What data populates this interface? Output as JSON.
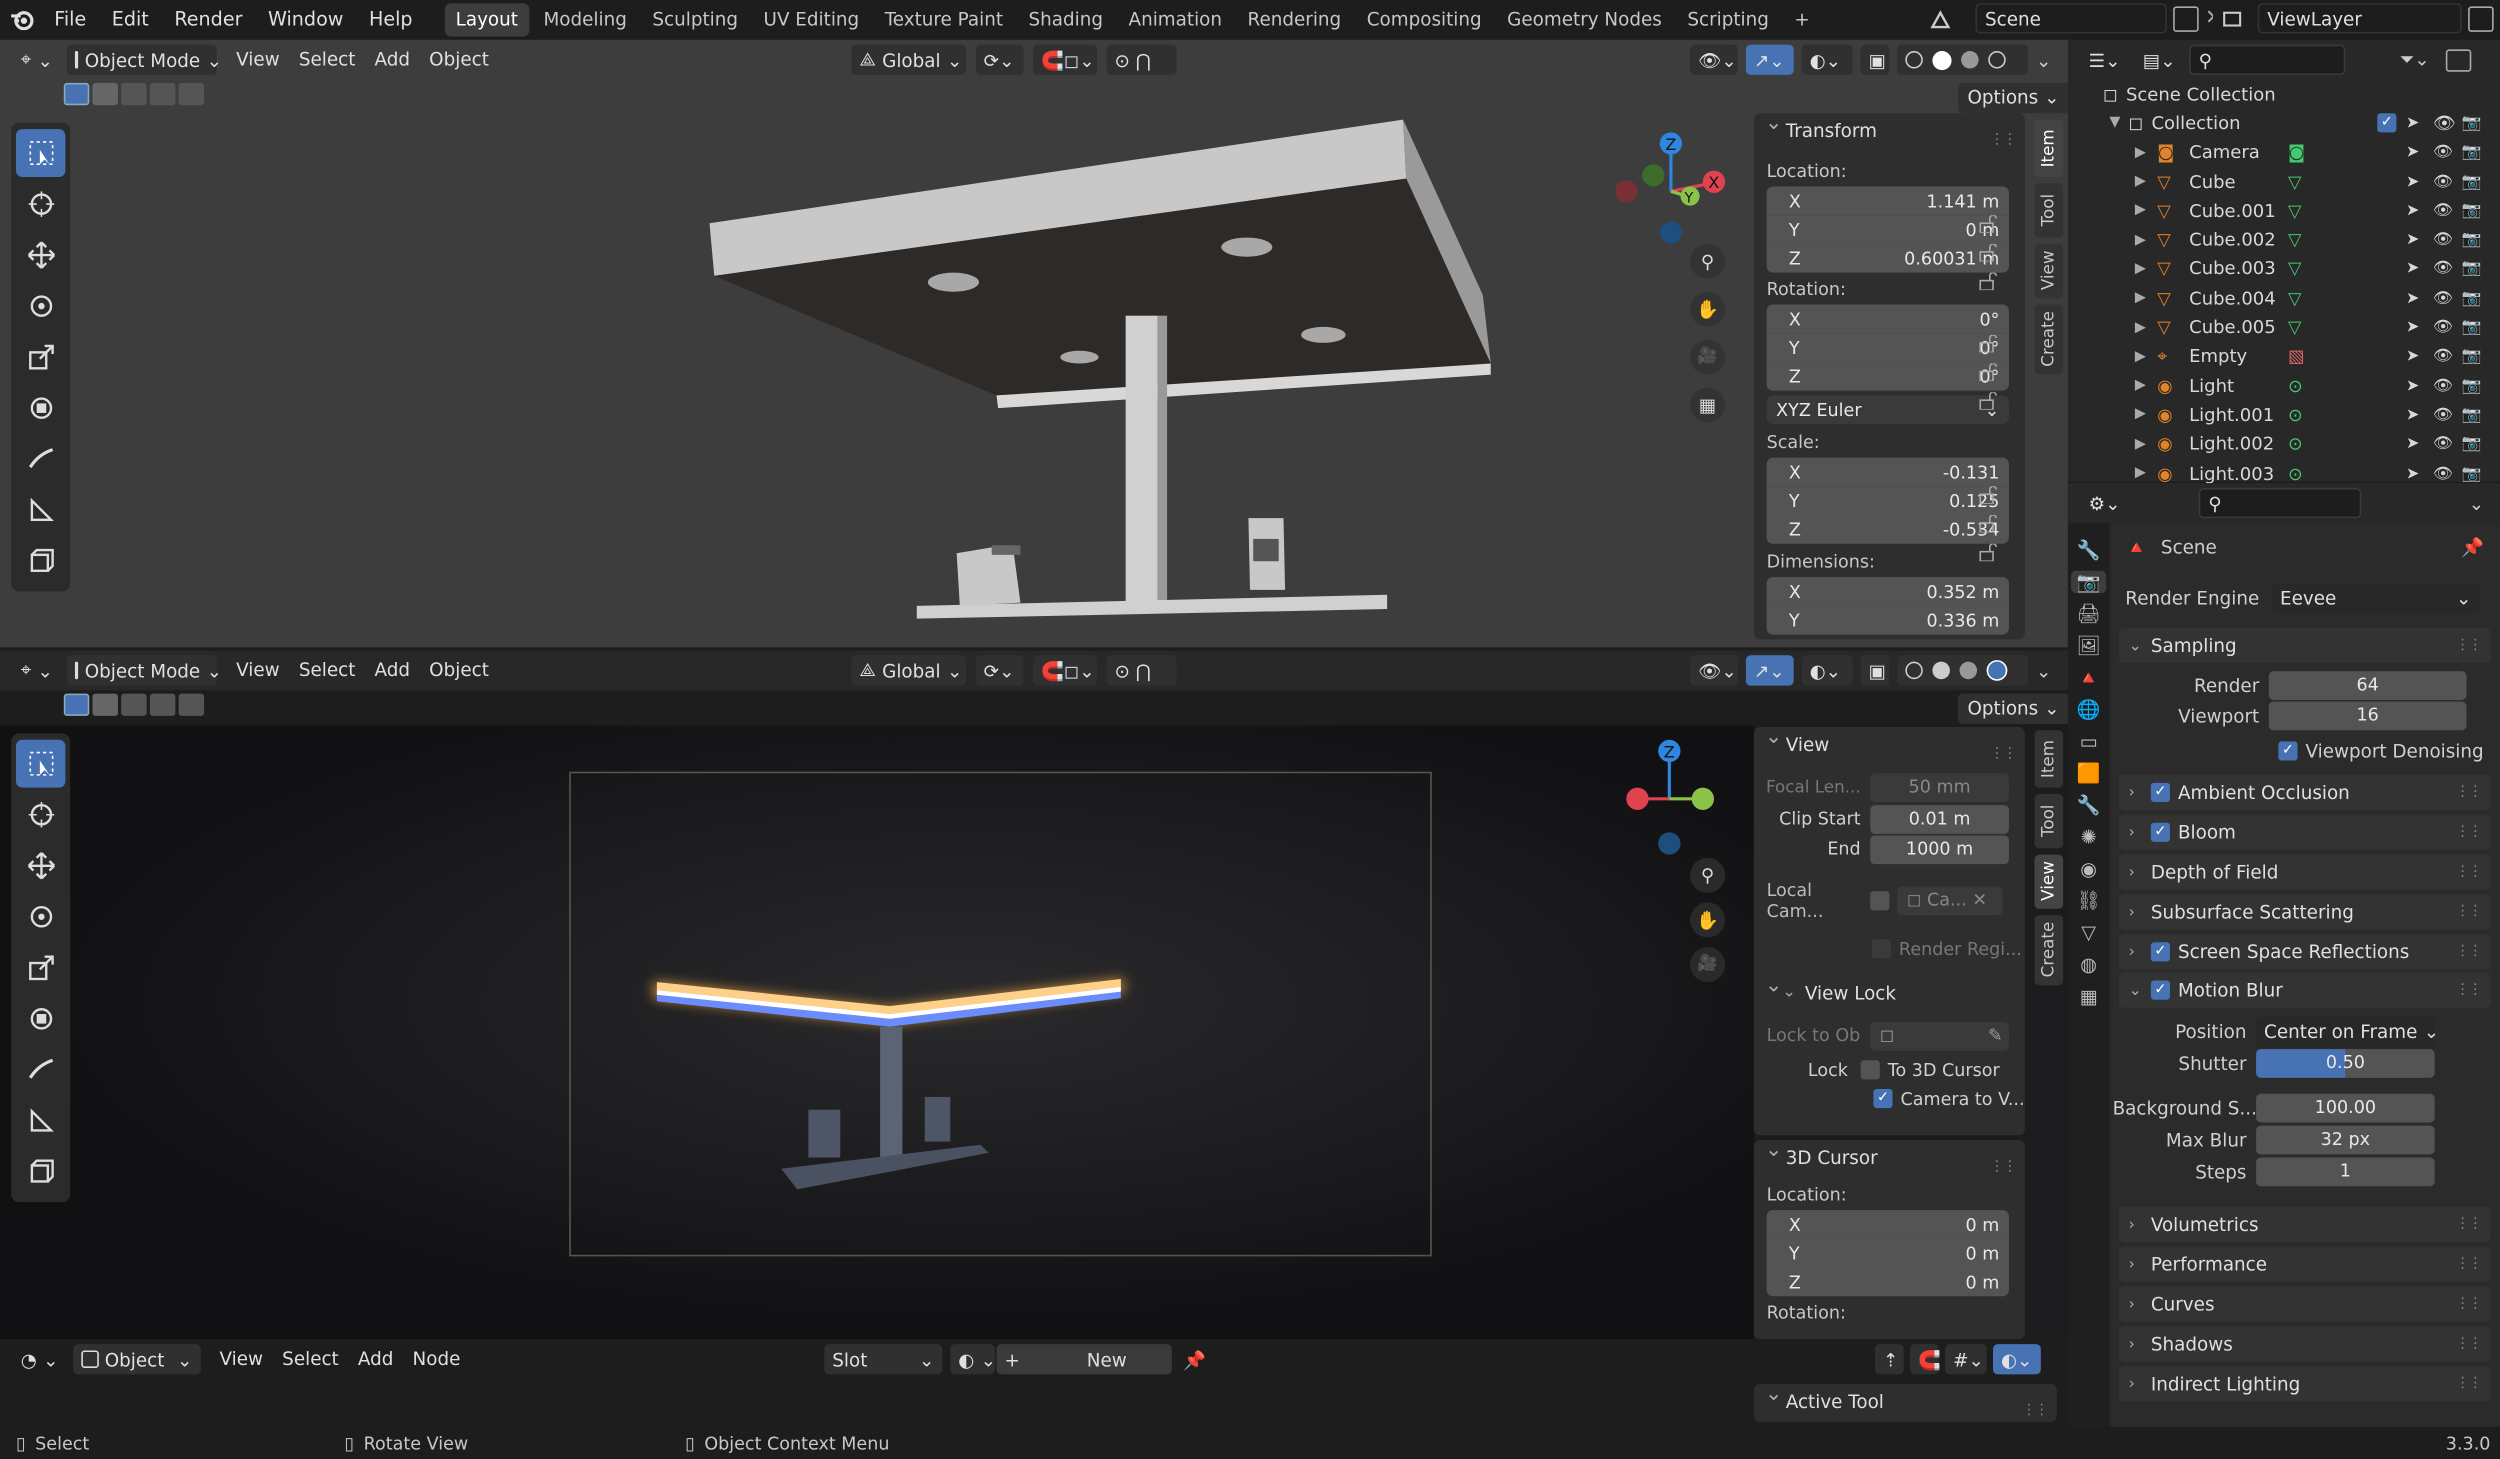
{
  "topbar": {
    "menus": [
      "File",
      "Edit",
      "Render",
      "Window",
      "Help"
    ],
    "workspaces": [
      "Layout",
      "Modeling",
      "Sculpting",
      "UV Editing",
      "Texture Paint",
      "Shading",
      "Animation",
      "Rendering",
      "Compositing",
      "Geometry Nodes",
      "Scripting"
    ],
    "active_workspace": "Layout",
    "add_tab": "+",
    "scene": "Scene",
    "view_layer": "ViewLayer"
  },
  "viewport_header": {
    "mode": "Object Mode",
    "menus": [
      "View",
      "Select",
      "Add",
      "Object"
    ],
    "orientation": "Global",
    "options": "Options"
  },
  "viewport1": {
    "npanel": {
      "title": "Transform",
      "location_label": "Location:",
      "location": [
        {
          "axis": "X",
          "value": "1.141 m"
        },
        {
          "axis": "Y",
          "value": "0 m"
        },
        {
          "axis": "Z",
          "value": "0.60031 m"
        }
      ],
      "rotation_label": "Rotation:",
      "rotation": [
        {
          "axis": "X",
          "value": "0°"
        },
        {
          "axis": "Y",
          "value": "0°"
        },
        {
          "axis": "Z",
          "value": "0°"
        }
      ],
      "rotation_mode": "XYZ Euler",
      "scale_label": "Scale:",
      "scale": [
        {
          "axis": "X",
          "value": "-0.131"
        },
        {
          "axis": "Y",
          "value": "0.125"
        },
        {
          "axis": "Z",
          "value": "-0.534"
        }
      ],
      "dimensions_label": "Dimensions:",
      "dimensions": [
        {
          "axis": "X",
          "value": "0.352 m"
        },
        {
          "axis": "Y",
          "value": "0.336 m"
        }
      ]
    },
    "tabs": [
      "Item",
      "Tool",
      "View",
      "Create"
    ],
    "gizmo": {
      "x": "X",
      "y": "Y",
      "z": "Z"
    }
  },
  "viewport2": {
    "view_panel": {
      "title": "View",
      "focal_label": "Focal Len...",
      "focal_value": "50 mm",
      "clip_start_label": "Clip Start",
      "clip_start_value": "0.01 m",
      "end_label": "End",
      "end_value": "1000 m",
      "local_cam_label": "Local Cam...",
      "local_cam_value": "Ca...",
      "render_region": "Render Regi...",
      "view_lock_title": "View Lock",
      "lock_to_ob_label": "Lock to Ob",
      "lock_label": "Lock",
      "to_3d_cursor": "To 3D Cursor",
      "camera_to_view": "Camera to V..."
    },
    "cursor_panel": {
      "title": "3D Cursor",
      "location_label": "Location:",
      "location": [
        {
          "axis": "X",
          "value": "0 m"
        },
        {
          "axis": "Y",
          "value": "0 m"
        },
        {
          "axis": "Z",
          "value": "0 m"
        }
      ],
      "rotation_label": "Rotation:"
    },
    "gizmo": {
      "z": "Z"
    }
  },
  "node_header": {
    "object": "Object",
    "menus": [
      "View",
      "Select",
      "Add",
      "Node"
    ],
    "slot": "Slot",
    "new": "New",
    "active_tool": "Active Tool"
  },
  "outliner": {
    "root": "Scene Collection",
    "collection": "Collection",
    "items": [
      {
        "name": "Camera",
        "icon": "camera-icon"
      },
      {
        "name": "Cube",
        "icon": "mesh-icon"
      },
      {
        "name": "Cube.001",
        "icon": "mesh-icon"
      },
      {
        "name": "Cube.002",
        "icon": "mesh-icon"
      },
      {
        "name": "Cube.003",
        "icon": "mesh-icon"
      },
      {
        "name": "Cube.004",
        "icon": "mesh-icon"
      },
      {
        "name": "Cube.005",
        "icon": "mesh-icon"
      },
      {
        "name": "Empty",
        "icon": "empty-icon"
      },
      {
        "name": "Light",
        "icon": "light-icon"
      },
      {
        "name": "Light.001",
        "icon": "light-icon"
      },
      {
        "name": "Light.002",
        "icon": "light-icon"
      },
      {
        "name": "Light.003",
        "icon": "light-icon"
      }
    ]
  },
  "properties": {
    "scene_label": "Scene",
    "render_engine_label": "Render Engine",
    "render_engine": "Eevee",
    "sampling": {
      "title": "Sampling",
      "render_label": "Render",
      "render_value": "64",
      "viewport_label": "Viewport",
      "viewport_value": "16",
      "denoise": "Viewport Denoising"
    },
    "panels": [
      {
        "name": "Ambient Occlusion",
        "checkbox": true,
        "checked": true
      },
      {
        "name": "Bloom",
        "checkbox": true,
        "checked": true
      },
      {
        "name": "Depth of Field",
        "checkbox": false
      },
      {
        "name": "Subsurface Scattering",
        "checkbox": false
      },
      {
        "name": "Screen Space Reflections",
        "checkbox": true,
        "checked": true
      }
    ],
    "motion_blur": {
      "title": "Motion Blur",
      "position_label": "Position",
      "position_value": "Center on Frame",
      "shutter_label": "Shutter",
      "shutter_value": "0.50",
      "shutter_fraction": 0.5,
      "bg_label": "Background S...",
      "bg_value": "100.00",
      "maxblur_label": "Max Blur",
      "maxblur_value": "32 px",
      "steps_label": "Steps",
      "steps_value": "1"
    },
    "more_panels": [
      "Volumetrics",
      "Performance",
      "Curves",
      "Shadows",
      "Indirect Lighting"
    ]
  },
  "statusbar": {
    "select": "Select",
    "rotate": "Rotate View",
    "context": "Object Context Menu",
    "version": "3.3.0"
  },
  "colors": {
    "accent": "#4772b3",
    "x_axis": "#e0424f",
    "y_axis": "#8bc34a",
    "z_axis": "#2e86de",
    "neon_orange": "#ffb347",
    "neon_blue": "#6a8cff"
  }
}
